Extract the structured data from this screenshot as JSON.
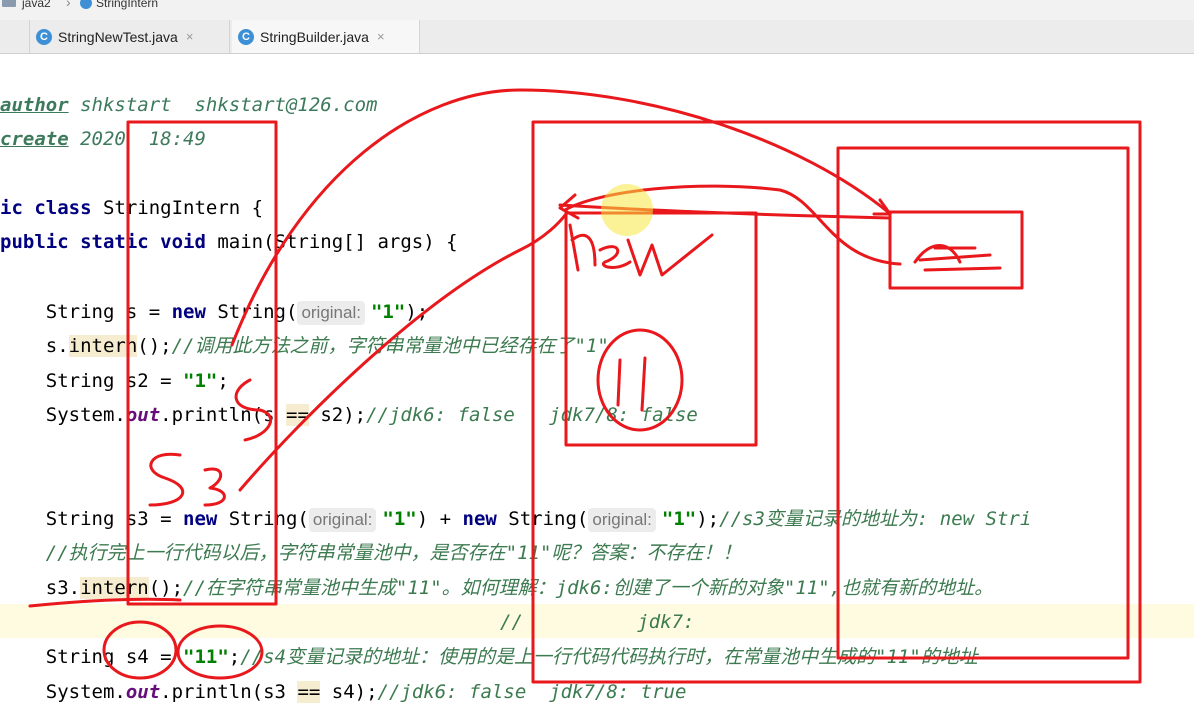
{
  "breadcrumb": {
    "project": "java2",
    "file": "StringIntern"
  },
  "tabs": [
    {
      "label": "StringNewTest.java",
      "icon": "C"
    },
    {
      "label": "StringBuilder.java",
      "icon": "C"
    }
  ],
  "tab_close_glyph": "×",
  "code": {
    "l1_tag": "author",
    "l1_rest": " shkstart  shkstart@126.com",
    "l2_tag": "create",
    "l2_rest": " 2020  18:49",
    "l3_kw": "ic class",
    "l3_rest": " StringIntern {",
    "l4_kw": "public static void",
    "l4_rest": " main(String[] args) {",
    "l5_a": "    String s = ",
    "l5_kw": "new",
    "l5_b": " String(",
    "l5_hint": "original:",
    "l5_str": "\"1\"",
    "l5_c": ");",
    "l6_a": "    s.",
    "l6_method": "intern",
    "l6_b": "();",
    "l6_cmt": "//调用此方法之前，字符串常量池中已经存在了\"1\"",
    "l7_a": "    String s2 = ",
    "l7_str": "\"1\"",
    "l7_b": ";",
    "l8_a": "    System.",
    "l8_field": "out",
    "l8_b": ".println(s ",
    "l8_op": "==",
    "l8_c": " s2);",
    "l8_cmt": "//jdk6: false   jdk7/8: false",
    "l9_a": "    String s3 = ",
    "l9_kw": "new",
    "l9_b": " String(",
    "l9_hint": "original:",
    "l9_str": "\"1\"",
    "l9_c": ") + ",
    "l9_kw2": "new",
    "l9_d": " String(",
    "l9_hint2": "original:",
    "l9_str2": "\"1\"",
    "l9_e": ");",
    "l9_cmt": "//s3变量记录的地址为: new Stri",
    "l10_cmt": "    //执行完上一行代码以后，字符串常量池中，是否存在\"11\"呢？答案：不存在！！",
    "l11_a": "    s3.",
    "l11_method": "intern",
    "l11_b": "();",
    "l11_cmt": "//在字符串常量池中生成\"11\"。如何理解：jdk6:创建了一个新的对象\"11\",也就有新的地址。",
    "l12_cmt": "//          jdk7:",
    "l13_a": "    String s4 = ",
    "l13_str": "\"11\"",
    "l13_b": ";",
    "l13_cmt": "//s4变量记录的地址：使用的是上一行代码代码执行时，在常量池中生成的\"11\"的地址",
    "l14_a": "    System.",
    "l14_field": "out",
    "l14_b": ".println(s3 ",
    "l14_op": "==",
    "l14_c": " s4);",
    "l14_cmt": "//jdk6: false  jdk7/8: true"
  },
  "colors": {
    "annotation": "#e8181c",
    "keyword": "#000080",
    "string": "#008000",
    "comment": "#3c7a4f",
    "hint_bg": "#ececec"
  }
}
